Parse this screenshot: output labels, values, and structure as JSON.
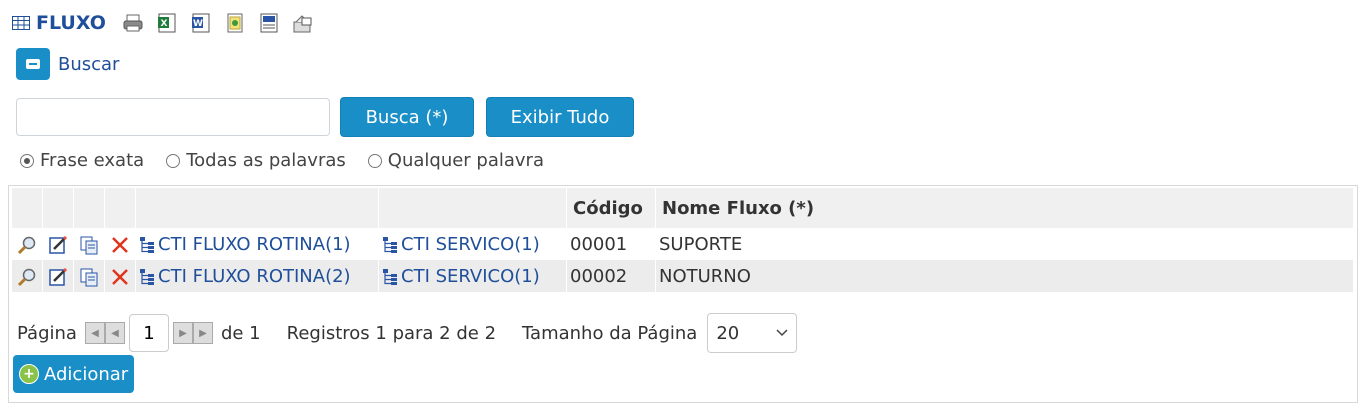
{
  "header": {
    "title": "FLUXO"
  },
  "search": {
    "toggle_label": "Buscar",
    "input_value": "",
    "search_button": "Busca (*)",
    "show_all_button": "Exibir Tudo",
    "options": [
      {
        "label": "Frase exata",
        "checked": true
      },
      {
        "label": "Todas as palavras",
        "checked": false
      },
      {
        "label": "Qualquer palavra",
        "checked": false
      }
    ]
  },
  "table": {
    "columns": [
      "",
      "",
      "",
      "",
      "",
      "",
      "Código",
      "Nome Fluxo (*)"
    ],
    "rows": [
      {
        "link1": "CTI FLUXO ROTINA(1)",
        "link2": "CTI SERVICO(1)",
        "codigo": "00001",
        "nome": "SUPORTE"
      },
      {
        "link1": "CTI FLUXO ROTINA(2)",
        "link2": "CTI SERVICO(1)",
        "codigo": "00002",
        "nome": "NOTURNO"
      }
    ]
  },
  "pager": {
    "page_label": "Página",
    "page_value": "1",
    "of_text": "de 1",
    "records_text": "Registros 1 para 2 de 2",
    "page_size_label": "Tamanho da Página",
    "page_size": "20"
  },
  "add_button": "Adicionar",
  "colors": {
    "accent": "#1a8fc7",
    "title": "#1f4f9a",
    "row_alt": "#ececec",
    "header": "#f0f0f0"
  }
}
